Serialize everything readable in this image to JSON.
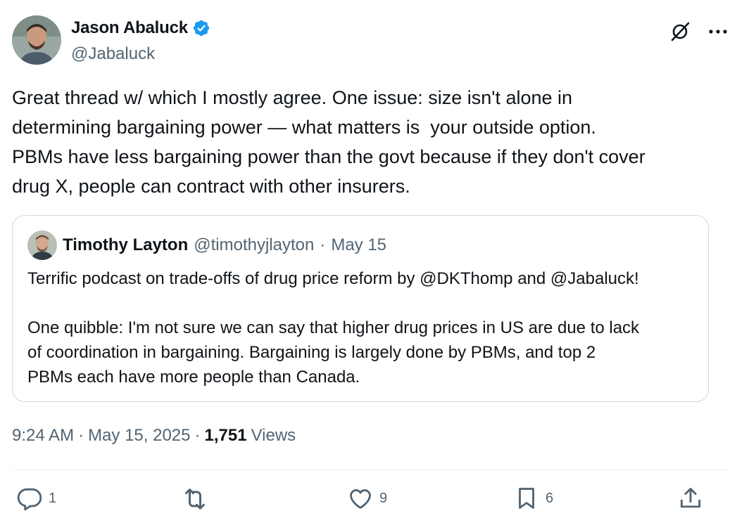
{
  "author": {
    "name": "Jason Abaluck",
    "handle": "@Jabaluck",
    "verified": true
  },
  "tweet": {
    "text": "Great thread w/ which I mostly agree. One issue: size isn't alone in\ndetermining bargaining power — what matters is  your outside option.\nPBMs have less bargaining power than the govt because if they don't cover\ndrug X, people can contract with other insurers."
  },
  "quoted": {
    "name": "Timothy Layton",
    "handle": "@timothyjlayton",
    "separator": "·",
    "date": "May 15",
    "text": "Terrific podcast on trade-offs of drug price reform by @DKThomp and @Jabaluck!\n\nOne quibble: I'm not sure we can say that higher drug prices in US are due to lack\nof coordination in bargaining. Bargaining is largely done by PBMs, and top 2\nPBMs each have more people than Canada."
  },
  "meta": {
    "time": "9:24 AM",
    "sep1": "·",
    "date": "May 15, 2025",
    "sep2": "·",
    "views_count": "1,751",
    "views_label": "Views"
  },
  "actions": {
    "replies": "1",
    "retweets": "",
    "likes": "9",
    "bookmarks": "6"
  },
  "icons": {
    "grok": "grok-icon",
    "more": "more-icon",
    "reply": "reply-icon",
    "retweet": "retweet-icon",
    "like": "heart-icon",
    "bookmark": "bookmark-icon",
    "share": "share-icon"
  },
  "colors": {
    "verified": "#1d9bf0",
    "text": "#0f1419",
    "secondary": "#536471",
    "border": "#cfd9de"
  }
}
